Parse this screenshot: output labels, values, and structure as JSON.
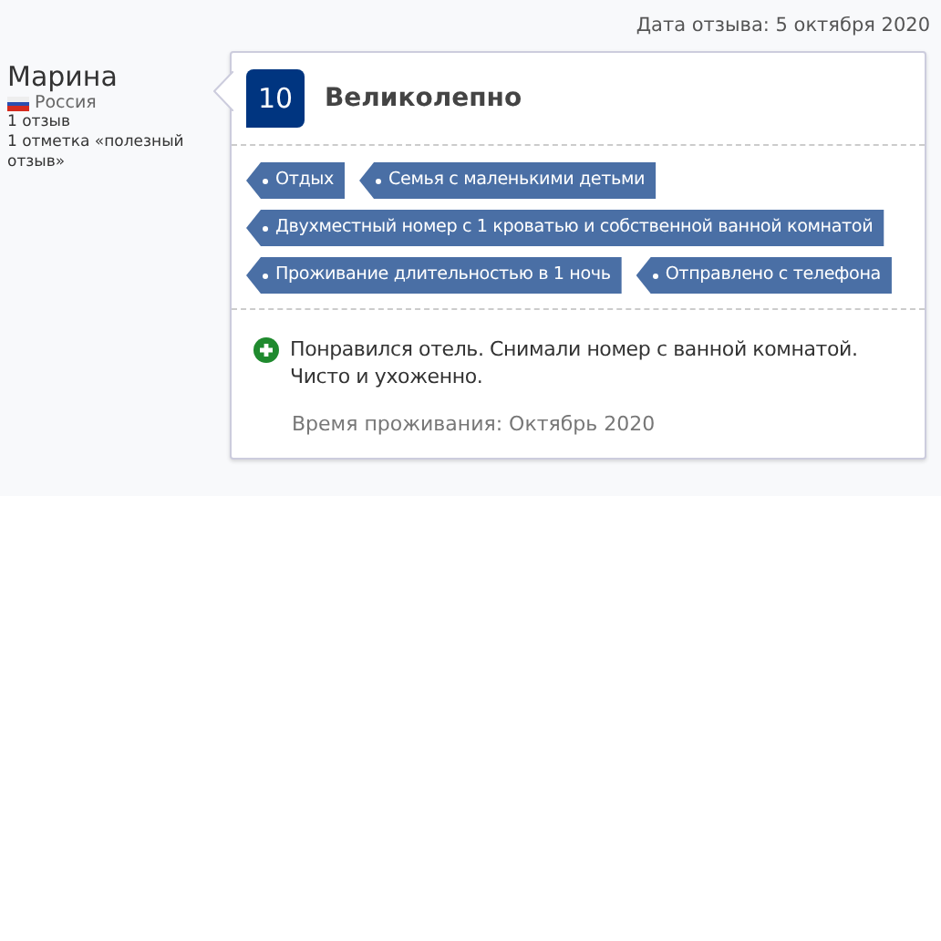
{
  "review_date": "Дата отзыва: 5 октября 2020",
  "reviewer": {
    "name": "Марина",
    "country": "Россия",
    "reviews": "1 отзыв",
    "helpful": "1 отметка «полезный отзыв»"
  },
  "score": "10",
  "verdict": "Великолепно",
  "tags": [
    "Отдых",
    "Семья с маленькими детьми",
    "Двухместный номер с 1 кроватью и собственной ванной комнатой",
    "Проживание длительностью в 1 ночь",
    "Отправлено с телефона"
  ],
  "positive": "Понравился отель. Снимали номер с ванной комнатой. Чисто и ухоженно.",
  "stay": "Время проживания: Октябрь 2020"
}
